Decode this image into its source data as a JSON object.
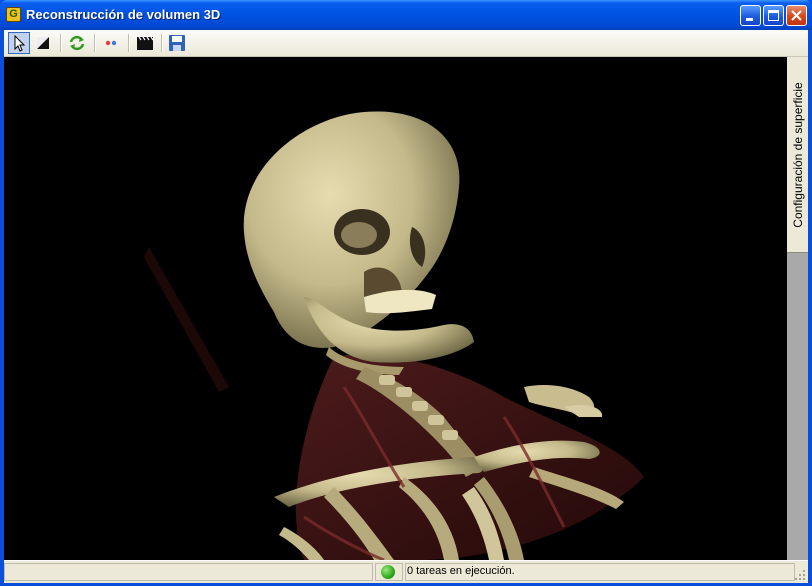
{
  "window": {
    "title": "Reconstrucción de volumen 3D",
    "app_icon_letter": "G"
  },
  "toolbar": {
    "tools": [
      "pointer-tool",
      "window-level-tool",
      "reload-tool",
      "stereo-tool",
      "video-tool",
      "save-tool"
    ]
  },
  "side_panel": {
    "tab_label": "Configuración de superficie"
  },
  "status": {
    "text": "0 tareas en ejecución.",
    "indicator_color": "#2fa81e"
  },
  "colors": {
    "title_bar": "#0054e3",
    "background": "#ece9d8",
    "viewport": "#000000",
    "bone": "#cfc59a"
  }
}
